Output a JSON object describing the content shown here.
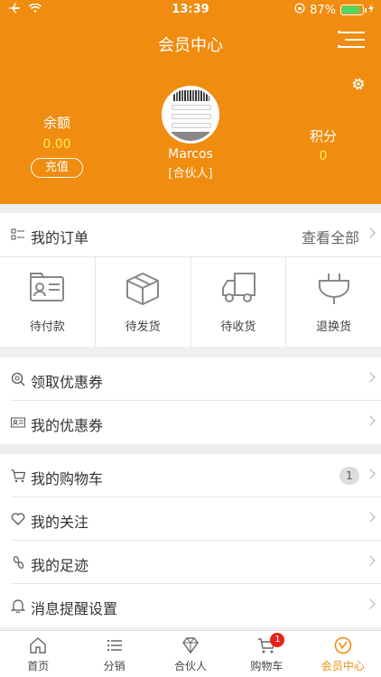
{
  "status_bar": {
    "time": "13:39",
    "battery_percent": "87%",
    "battery_level": 0.87
  },
  "header": {
    "title": "会员中心",
    "balance_label": "余额",
    "balance_value": "0.00",
    "recharge_label": "充值",
    "points_label": "积分",
    "points_value": "0",
    "username": "Marcos",
    "role": "[合伙人]"
  },
  "orders": {
    "title": "我的订单",
    "view_all": "查看全部",
    "statuses": [
      {
        "label": "待付款",
        "icon": "wallet-card-icon"
      },
      {
        "label": "待发货",
        "icon": "box-icon"
      },
      {
        "label": "待收货",
        "icon": "truck-icon"
      },
      {
        "label": "退换货",
        "icon": "plug-icon"
      }
    ]
  },
  "coupons": {
    "items": [
      {
        "label": "领取优惠券",
        "icon": "coupon-search-icon"
      },
      {
        "label": "我的优惠券",
        "icon": "id-card-icon"
      }
    ]
  },
  "menu": {
    "items": [
      {
        "label": "我的购物车",
        "icon": "cart-icon",
        "count": "1"
      },
      {
        "label": "我的关注",
        "icon": "heart-icon"
      },
      {
        "label": "我的足迹",
        "icon": "footprint-icon"
      },
      {
        "label": "消息提醒设置",
        "icon": "bell-icon"
      }
    ]
  },
  "tabbar": {
    "tabs": [
      {
        "label": "首页",
        "icon": "home-icon"
      },
      {
        "label": "分销",
        "icon": "list-icon"
      },
      {
        "label": "合伙人",
        "icon": "diamond-icon"
      },
      {
        "label": "购物车",
        "icon": "cart-icon",
        "badge": "1"
      },
      {
        "label": "会员中心",
        "icon": "member-icon",
        "active": true
      }
    ]
  },
  "colors": {
    "accent": "#f08c0f",
    "value_yellow": "#ffee58",
    "badge_red": "#e8221b"
  }
}
